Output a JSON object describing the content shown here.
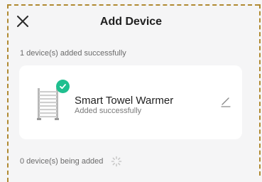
{
  "header": {
    "title": "Add Device",
    "close_icon": "close-icon"
  },
  "added_section": {
    "label": "1 device(s) added successfully"
  },
  "device": {
    "name": "Smart Towel Warmer",
    "status": "Added successfully",
    "image_icon": "towel-warmer-icon",
    "badge_icon": "check-icon",
    "edit_icon": "pencil-icon"
  },
  "pending_section": {
    "label": "0 device(s) being added",
    "spinner_icon": "loading-spinner-icon"
  },
  "colors": {
    "success": "#1fbf8f",
    "frame": "#b08a32"
  }
}
